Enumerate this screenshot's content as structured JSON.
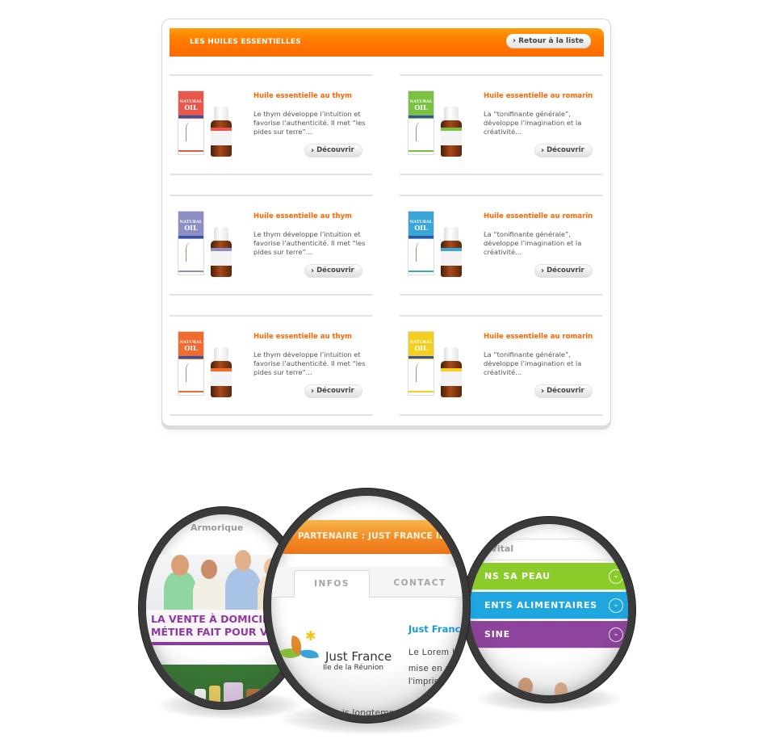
{
  "panel": {
    "title": "LES HUILES ESSENTIELLES",
    "back_button": "Retour à la liste",
    "chevron_glyph": "›",
    "accent_color": "#ff6600"
  },
  "products": [
    {
      "title": "Huile essentielle au thym",
      "description": "Le thym développe l’intuition et favorise l’authenticité. Il met “les pides sur terre”...",
      "button": "Découvrir",
      "box_color": "#e8584a",
      "theme": "red"
    },
    {
      "title": "Huile essentielle au romarin",
      "description": "La “tonifinante générale”, développe l’imagination et la créativité...",
      "button": "Découvrir",
      "box_color": "#7ac142",
      "theme": "green"
    },
    {
      "title": "Huile essentielle au thym",
      "description": "Le thym développe l’intuition et favorise l’authenticité. Il met “les pides sur terre”...",
      "button": "Découvrir",
      "box_color": "#8d8fc4",
      "theme": "lavender"
    },
    {
      "title": "Huile essentielle au romarin",
      "description": "La “tonifinante générale”, développe l’imagination et la créativité...",
      "button": "Découvrir",
      "box_color": "#3aa6d8",
      "theme": "blue"
    },
    {
      "title": "Huile essentielle au thym",
      "description": "Le thym développe l’intuition et favorise l’authenticité. Il met “les pides sur terre”...",
      "button": "Découvrir",
      "box_color": "#f26a2e",
      "theme": "orange"
    },
    {
      "title": "Huile essentielle au romarin",
      "description": "La “tonifinante générale”, développe l’imagination et la créativité...",
      "button": "Découvrir",
      "box_color": "#f3d020",
      "theme": "yellow"
    }
  ],
  "product_brand": {
    "small": "NATURAL",
    "big": "OIL"
  },
  "lens_left": {
    "site_name": "Armorique",
    "headline_1": "LA VENTE À DOMICILE",
    "headline_2": "MÉTIER FAIT POUR V",
    "accent_color": "#8e3aa0"
  },
  "lens_center": {
    "bar_title": "PARTENAIRE : JUST FRANCE ILE DE",
    "tabs": [
      {
        "label": "INFOS",
        "active": true
      },
      {
        "label": "CONTACT",
        "active": false
      }
    ],
    "logo_name": "Just France",
    "logo_sub": "Ile de la Réunion",
    "partner_title": "Just France Île",
    "text_lines": [
      "Le Lorem Ips",
      "mise  en p",
      "l'imprimeri"
    ],
    "bottom_text": "is longtemps qu",
    "title_color": "#1a9ad6"
  },
  "lens_right": {
    "site_name": "st-Vital",
    "menu": [
      {
        "label": "NS SA PEAU",
        "color": "#8ccc2a"
      },
      {
        "label": "ENTS ALIMENTAIRES",
        "color": "#1ea6e0"
      },
      {
        "label": "SINE",
        "color": "#8e449c"
      }
    ],
    "chevron_glyph": "⌄"
  }
}
